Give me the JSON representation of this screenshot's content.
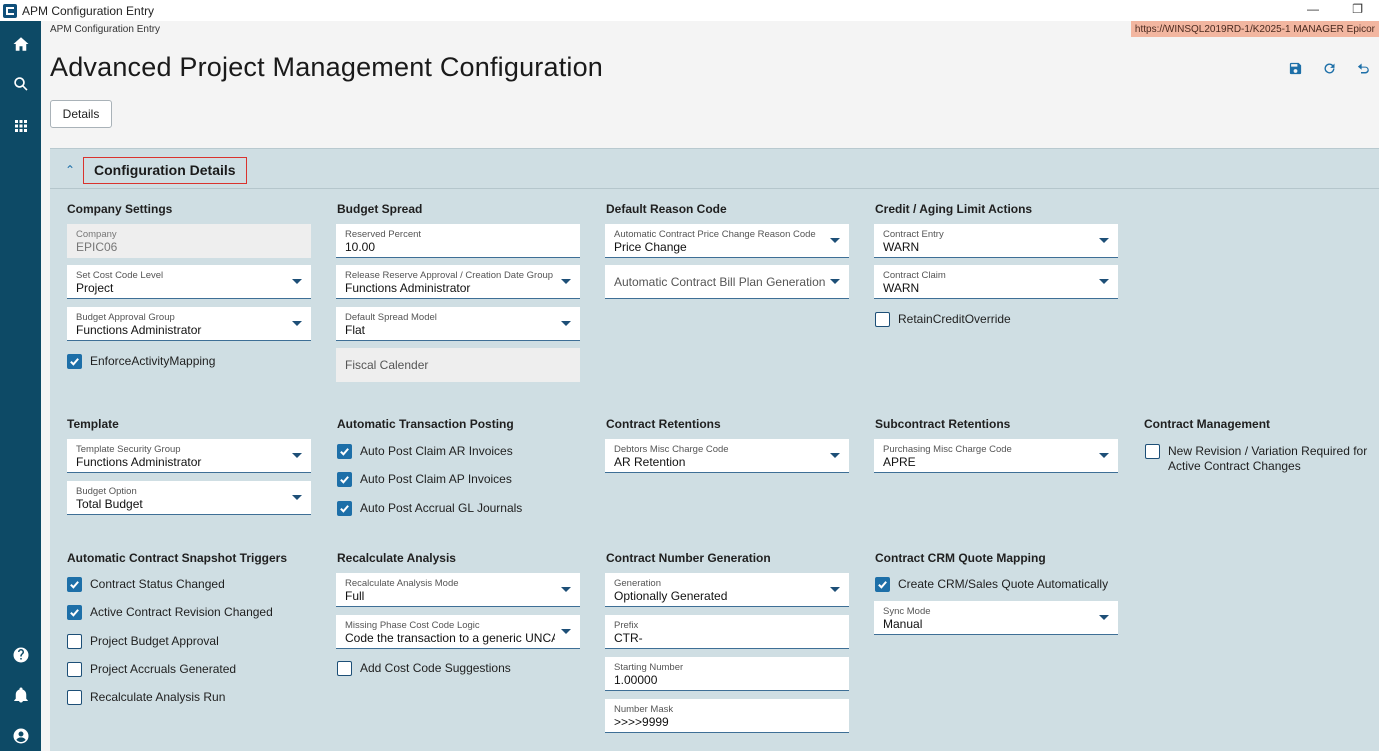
{
  "window": {
    "title": "APM Configuration Entry",
    "minimize_glyph": "—",
    "restore_glyph": "❐"
  },
  "nav": {
    "icons": [
      "home-icon",
      "search-icon",
      "apps-grid-icon",
      "help-icon",
      "bell-icon",
      "user-icon"
    ]
  },
  "header": {
    "breadcrumb": "APM Configuration Entry",
    "server_info": "https://WINSQL2019RD-1/K2025-1  MANAGER  Epicor",
    "page_title": "Advanced Project Management Configuration",
    "toolbar_icons": [
      "save-icon",
      "refresh-icon",
      "undo-icon"
    ],
    "details_button": "Details"
  },
  "panel": {
    "title": "Configuration Details",
    "accent_color": "#d9332e"
  },
  "sections": {
    "company_settings": {
      "title": "Company Settings",
      "company_label": "Company",
      "company_value": "EPIC06",
      "cost_code_level_label": "Set Cost Code Level",
      "cost_code_level_value": "Project",
      "budget_approval_label": "Budget Approval Group",
      "budget_approval_value": "Functions Administrator",
      "enforce_activity_label": "EnforceActivityMapping",
      "enforce_activity_checked": true
    },
    "budget_spread": {
      "title": "Budget Spread",
      "reserved_percent_label": "Reserved Percent",
      "reserved_percent_value": "10.00",
      "release_reserve_label": "Release Reserve Approval / Creation Date Group",
      "release_reserve_value": "Functions Administrator",
      "spread_model_label": "Default Spread Model",
      "spread_model_value": "Flat",
      "fiscal_calendar_placeholder": "Fiscal Calender"
    },
    "default_reason_code": {
      "title": "Default Reason Code",
      "price_change_label": "Automatic Contract Price Change Reason Code",
      "price_change_value": "Price Change",
      "bill_plan_placeholder": "Automatic Contract Bill Plan Generation R..."
    },
    "credit_aging": {
      "title": "Credit / Aging Limit Actions",
      "contract_entry_label": "Contract Entry",
      "contract_entry_value": "WARN",
      "contract_claim_label": "Contract Claim",
      "contract_claim_value": "WARN",
      "retain_credit_label": "RetainCreditOverride",
      "retain_credit_checked": false
    },
    "template": {
      "title": "Template",
      "security_group_label": "Template Security Group",
      "security_group_value": "Functions Administrator",
      "budget_option_label": "Budget Option",
      "budget_option_value": "Total Budget"
    },
    "auto_posting": {
      "title": "Automatic Transaction Posting",
      "items": [
        {
          "label": "Auto Post Claim AR Invoices",
          "checked": true
        },
        {
          "label": "Auto Post Claim AP Invoices",
          "checked": true
        },
        {
          "label": "Auto Post Accrual GL Journals",
          "checked": true
        }
      ]
    },
    "contract_retentions": {
      "title": "Contract Retentions",
      "debtors_label": "Debtors Misc Charge Code",
      "debtors_value": "AR Retention"
    },
    "subcontract_retentions": {
      "title": "Subcontract Retentions",
      "purchasing_label": "Purchasing Misc Charge Code",
      "purchasing_value": "APRE"
    },
    "contract_management": {
      "title": "Contract Management",
      "new_revision_line1": "New Revision / Variation Required for",
      "new_revision_line2": "Active Contract Changes",
      "new_revision_checked": false
    },
    "snapshot_triggers": {
      "title": "Automatic Contract Snapshot Triggers",
      "items": [
        {
          "label": "Contract Status Changed",
          "checked": true
        },
        {
          "label": "Active Contract Revision Changed",
          "checked": true
        },
        {
          "label": "Project Budget Approval",
          "checked": false
        },
        {
          "label": "Project Accruals Generated",
          "checked": false
        },
        {
          "label": "Recalculate Analysis Run",
          "checked": false
        }
      ]
    },
    "recalculate_analysis": {
      "title": "Recalculate Analysis",
      "mode_label": "Recalculate Analysis Mode",
      "mode_value": "Full",
      "missing_phase_label": "Missing Phase Cost Code Logic",
      "missing_phase_value": "Code the transaction to a generic UNCATE...",
      "suggestions_label": "Add Cost Code Suggestions",
      "suggestions_checked": false
    },
    "contract_number": {
      "title": "Contract Number Generation",
      "generation_label": "Generation",
      "generation_value": "Optionally Generated",
      "prefix_label": "Prefix",
      "prefix_value": "CTR-",
      "starting_label": "Starting Number",
      "starting_value": "1.00000",
      "mask_label": "Number Mask",
      "mask_value": ">>>>9999"
    },
    "crm_mapping": {
      "title": "Contract CRM Quote Mapping",
      "create_quote_label": "Create CRM/Sales Quote Automatically",
      "create_quote_checked": true,
      "sync_mode_label": "Sync Mode",
      "sync_mode_value": "Manual"
    }
  }
}
